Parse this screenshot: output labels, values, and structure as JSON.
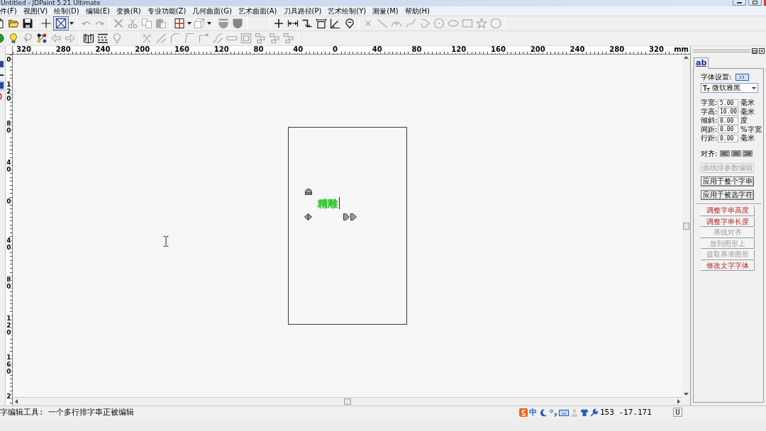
{
  "window": {
    "title": "Untitled - JDPaint 5.21 Ultimate"
  },
  "menu": [
    "件(F)",
    "视图(V)",
    "绘制(D)",
    "编辑(E)",
    "变换(R)",
    "专业功能(Z)",
    "几何曲面(G)",
    "艺术曲面(A)",
    "刀具路径(P)",
    "艺术绘制(Y)",
    "测量(M)",
    "帮助(H)"
  ],
  "toolbar_1": [
    {
      "kind": "new",
      "disabled": false,
      "pressed": false
    },
    {
      "kind": "open",
      "disabled": false,
      "pressed": false
    },
    {
      "kind": "save",
      "disabled": false,
      "pressed": false
    },
    {
      "kind": "separator"
    },
    {
      "kind": "crosshair",
      "disabled": false,
      "pressed": false
    },
    {
      "kind": "select",
      "disabled": false,
      "pressed": true
    },
    {
      "kind": "caret",
      "disabled": false,
      "pressed": false
    },
    {
      "kind": "separator"
    },
    {
      "kind": "undo",
      "disabled": true,
      "pressed": false
    },
    {
      "kind": "redo",
      "disabled": true,
      "pressed": false
    },
    {
      "kind": "separator"
    },
    {
      "kind": "delete",
      "disabled": true,
      "pressed": false
    },
    {
      "kind": "cut",
      "disabled": true,
      "pressed": false
    },
    {
      "kind": "copy",
      "disabled": true,
      "pressed": false
    },
    {
      "kind": "paste",
      "disabled": true,
      "pressed": false
    },
    {
      "kind": "separator"
    },
    {
      "kind": "view",
      "disabled": false,
      "pressed": false
    },
    {
      "kind": "caret",
      "disabled": false,
      "pressed": false
    },
    {
      "kind": "cube",
      "disabled": true,
      "pressed": false
    },
    {
      "kind": "caret",
      "disabled": false,
      "pressed": false
    },
    {
      "kind": "separator"
    },
    {
      "kind": "shield",
      "disabled": false,
      "pressed": false
    },
    {
      "kind": "shield2",
      "disabled": false,
      "pressed": false
    },
    {
      "kind": "separator"
    },
    {
      "kind": "gap"
    },
    {
      "kind": "separator"
    },
    {
      "kind": "point",
      "disabled": false,
      "pressed": false
    },
    {
      "kind": "hdim",
      "disabled": false,
      "pressed": false
    },
    {
      "kind": "step",
      "disabled": false,
      "pressed": false
    },
    {
      "kind": "boxdim",
      "disabled": false,
      "pressed": false
    },
    {
      "kind": "angle",
      "disabled": false,
      "pressed": false
    },
    {
      "kind": "balloon",
      "disabled": false,
      "pressed": false
    },
    {
      "kind": "separator"
    },
    {
      "kind": "xmark",
      "disabled": true,
      "pressed": false
    },
    {
      "kind": "line",
      "disabled": true,
      "pressed": false
    },
    {
      "kind": "arc",
      "disabled": true,
      "pressed": false
    },
    {
      "kind": "curve",
      "disabled": true,
      "pressed": false
    },
    {
      "kind": "polyline",
      "disabled": true,
      "pressed": false
    },
    {
      "kind": "circle",
      "disabled": true,
      "pressed": false
    },
    {
      "kind": "ellipse",
      "disabled": true,
      "pressed": false
    },
    {
      "kind": "rect",
      "disabled": true,
      "pressed": false
    },
    {
      "kind": "star",
      "disabled": true,
      "pressed": false
    },
    {
      "kind": "polygon",
      "disabled": true,
      "pressed": false
    },
    {
      "kind": "separator"
    }
  ],
  "toolbar_2": [
    {
      "kind": "dot",
      "disabled": false,
      "pressed": false
    },
    {
      "kind": "bulb",
      "disabled": false,
      "pressed": false
    },
    {
      "kind": "bulbpick",
      "disabled": true,
      "pressed": false
    },
    {
      "kind": "nodes",
      "disabled": false,
      "pressed": false
    },
    {
      "kind": "left",
      "disabled": true,
      "pressed": false
    },
    {
      "kind": "right",
      "disabled": true,
      "pressed": false
    },
    {
      "kind": "separator"
    },
    {
      "kind": "pages",
      "disabled": false,
      "pressed": false
    },
    {
      "kind": "dashes",
      "disabled": false,
      "pressed": false
    },
    {
      "kind": "bulbout",
      "disabled": true,
      "pressed": false
    },
    {
      "kind": "gap"
    },
    {
      "kind": "separator"
    },
    {
      "kind": "trim",
      "disabled": true,
      "pressed": false
    },
    {
      "kind": "lineangle",
      "disabled": true,
      "pressed": false
    },
    {
      "kind": "corner",
      "disabled": true,
      "pressed": false
    },
    {
      "kind": "corner2",
      "disabled": true,
      "pressed": false
    },
    {
      "kind": "cornerdot",
      "disabled": true,
      "pressed": false
    },
    {
      "kind": "fillet",
      "disabled": true,
      "pressed": false
    },
    {
      "kind": "slot",
      "disabled": true,
      "pressed": false
    },
    {
      "kind": "frame",
      "disabled": true,
      "pressed": false
    },
    {
      "kind": "group",
      "disabled": true,
      "pressed": false
    },
    {
      "kind": "group",
      "disabled": true,
      "pressed": false
    },
    {
      "kind": "group",
      "disabled": true,
      "pressed": false
    },
    {
      "kind": "separator"
    }
  ],
  "left_tools": [
    {
      "kind": "square",
      "selected": false
    },
    {
      "kind": "dash",
      "selected": false
    },
    {
      "kind": "square",
      "selected": true
    },
    {
      "kind": "arc",
      "selected": false
    }
  ],
  "ruler_h": {
    "labels": [
      "320",
      "280",
      "240",
      "200",
      "160",
      "120",
      "80",
      "40",
      "0",
      "40",
      "80",
      "120",
      "160",
      "200",
      "240",
      "280",
      "320"
    ],
    "unit": "mm"
  },
  "ruler_v": {
    "labels": [
      "0",
      "120",
      "80",
      "40",
      "0",
      "40",
      "80",
      "120",
      "160",
      "2"
    ]
  },
  "canvas": {
    "text": "精雕"
  },
  "panel": {
    "tab": {
      "label": "ab",
      "selected": true
    },
    "font_label": "字体设置:",
    "font": "微软雅黑",
    "fields": [
      {
        "label": "字宽:",
        "value": "5.00",
        "unit": "毫米"
      },
      {
        "label": "字高:",
        "value": "10.00",
        "unit": "毫米"
      },
      {
        "label": "倾斜:",
        "value": "0.00",
        "unit": "度"
      },
      {
        "label": "间距:",
        "value": "0.00",
        "unit": "%字宽"
      },
      {
        "label": "行距:",
        "value": "0.00",
        "unit": "毫米"
      }
    ],
    "align_label": "对齐:",
    "apply_buttons": [
      {
        "label": "曲线排参数编辑",
        "disabled": true
      },
      {
        "label": "应用于整个字串",
        "disabled": false
      },
      {
        "label": "应用于被选字符",
        "disabled": false
      }
    ],
    "adjust_buttons": [
      {
        "label": "调整字串高度",
        "disabled": false
      },
      {
        "label": "调整字串长度",
        "disabled": false
      },
      {
        "label": "基线对齐",
        "disabled": true
      },
      {
        "label": "放到图形上",
        "disabled": true
      },
      {
        "label": "提取基准图形",
        "disabled": true
      },
      {
        "label": "修改文字字体",
        "disabled": false
      }
    ]
  },
  "status_bar": {
    "message": "字编辑工具: 一个多行排字串正被编辑",
    "ime": "中",
    "coords": "153 -17.171",
    "mode": "U"
  }
}
